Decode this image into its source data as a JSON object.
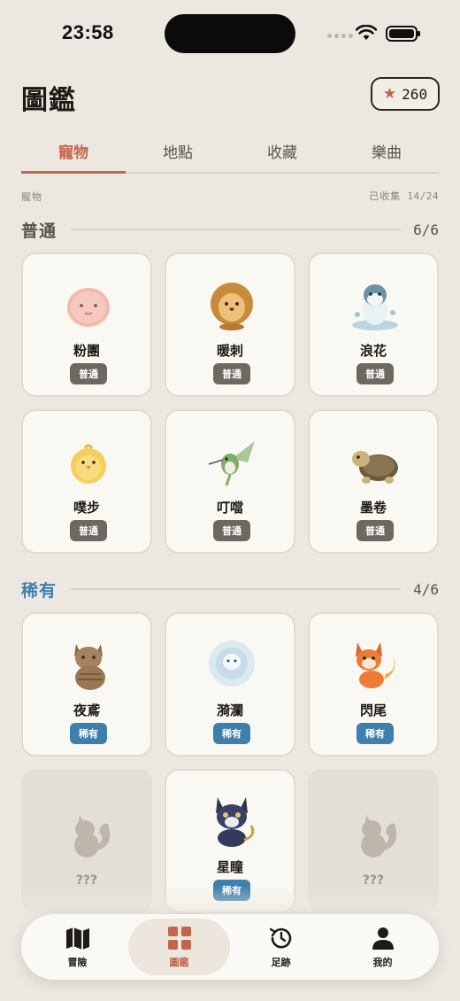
{
  "status_bar": {
    "time": "23:58"
  },
  "header": {
    "title": "圖鑑",
    "stars": "260"
  },
  "tabs": [
    {
      "label": "寵物",
      "active": true
    },
    {
      "label": "地點",
      "active": false
    },
    {
      "label": "收藏",
      "active": false
    },
    {
      "label": "樂曲",
      "active": false
    }
  ],
  "section": {
    "label": "寵物",
    "collected_label": "已收集",
    "collected_value": "14/24"
  },
  "groups": {
    "common": {
      "name": "普通",
      "count": "6/6",
      "color": "#5a534b",
      "pets": [
        {
          "name": "粉團",
          "badge": "普通",
          "icon": "pink-fluff-icon"
        },
        {
          "name": "暖刺",
          "badge": "普通",
          "icon": "hedgehog-icon"
        },
        {
          "name": "浪花",
          "badge": "普通",
          "icon": "seal-splash-icon"
        },
        {
          "name": "噗步",
          "badge": "普通",
          "icon": "chick-icon"
        },
        {
          "name": "叮噹",
          "badge": "普通",
          "icon": "hummingbird-icon"
        },
        {
          "name": "墨卷",
          "badge": "普通",
          "icon": "turtle-icon"
        }
      ]
    },
    "rare": {
      "name": "稀有",
      "count": "4/6",
      "color": "#3f7fae",
      "pets": [
        {
          "name": "夜鳶",
          "badge": "稀有",
          "icon": "tabby-cat-icon"
        },
        {
          "name": "漪瀾",
          "badge": "稀有",
          "icon": "water-spirit-icon"
        },
        {
          "name": "閃尾",
          "badge": "稀有",
          "icon": "fire-fox-icon"
        },
        {
          "name": "???",
          "locked": true,
          "icon": "squirrel-silhouette-icon"
        },
        {
          "name": "星瞳",
          "badge": "稀有",
          "icon": "night-cat-icon"
        },
        {
          "name": "???",
          "locked": true,
          "icon": "squirrel-silhouette-icon"
        }
      ]
    }
  },
  "nav": [
    {
      "label": "冒險",
      "icon": "map-icon",
      "active": false
    },
    {
      "label": "圖鑑",
      "icon": "grid-icon",
      "active": true
    },
    {
      "label": "足跡",
      "icon": "history-icon",
      "active": false
    },
    {
      "label": "我的",
      "icon": "person-icon",
      "active": false
    }
  ],
  "colors": {
    "accent": "#c3654a",
    "rare": "#3f7fae",
    "common": "#6e6861",
    "background": "#ece8e1"
  }
}
